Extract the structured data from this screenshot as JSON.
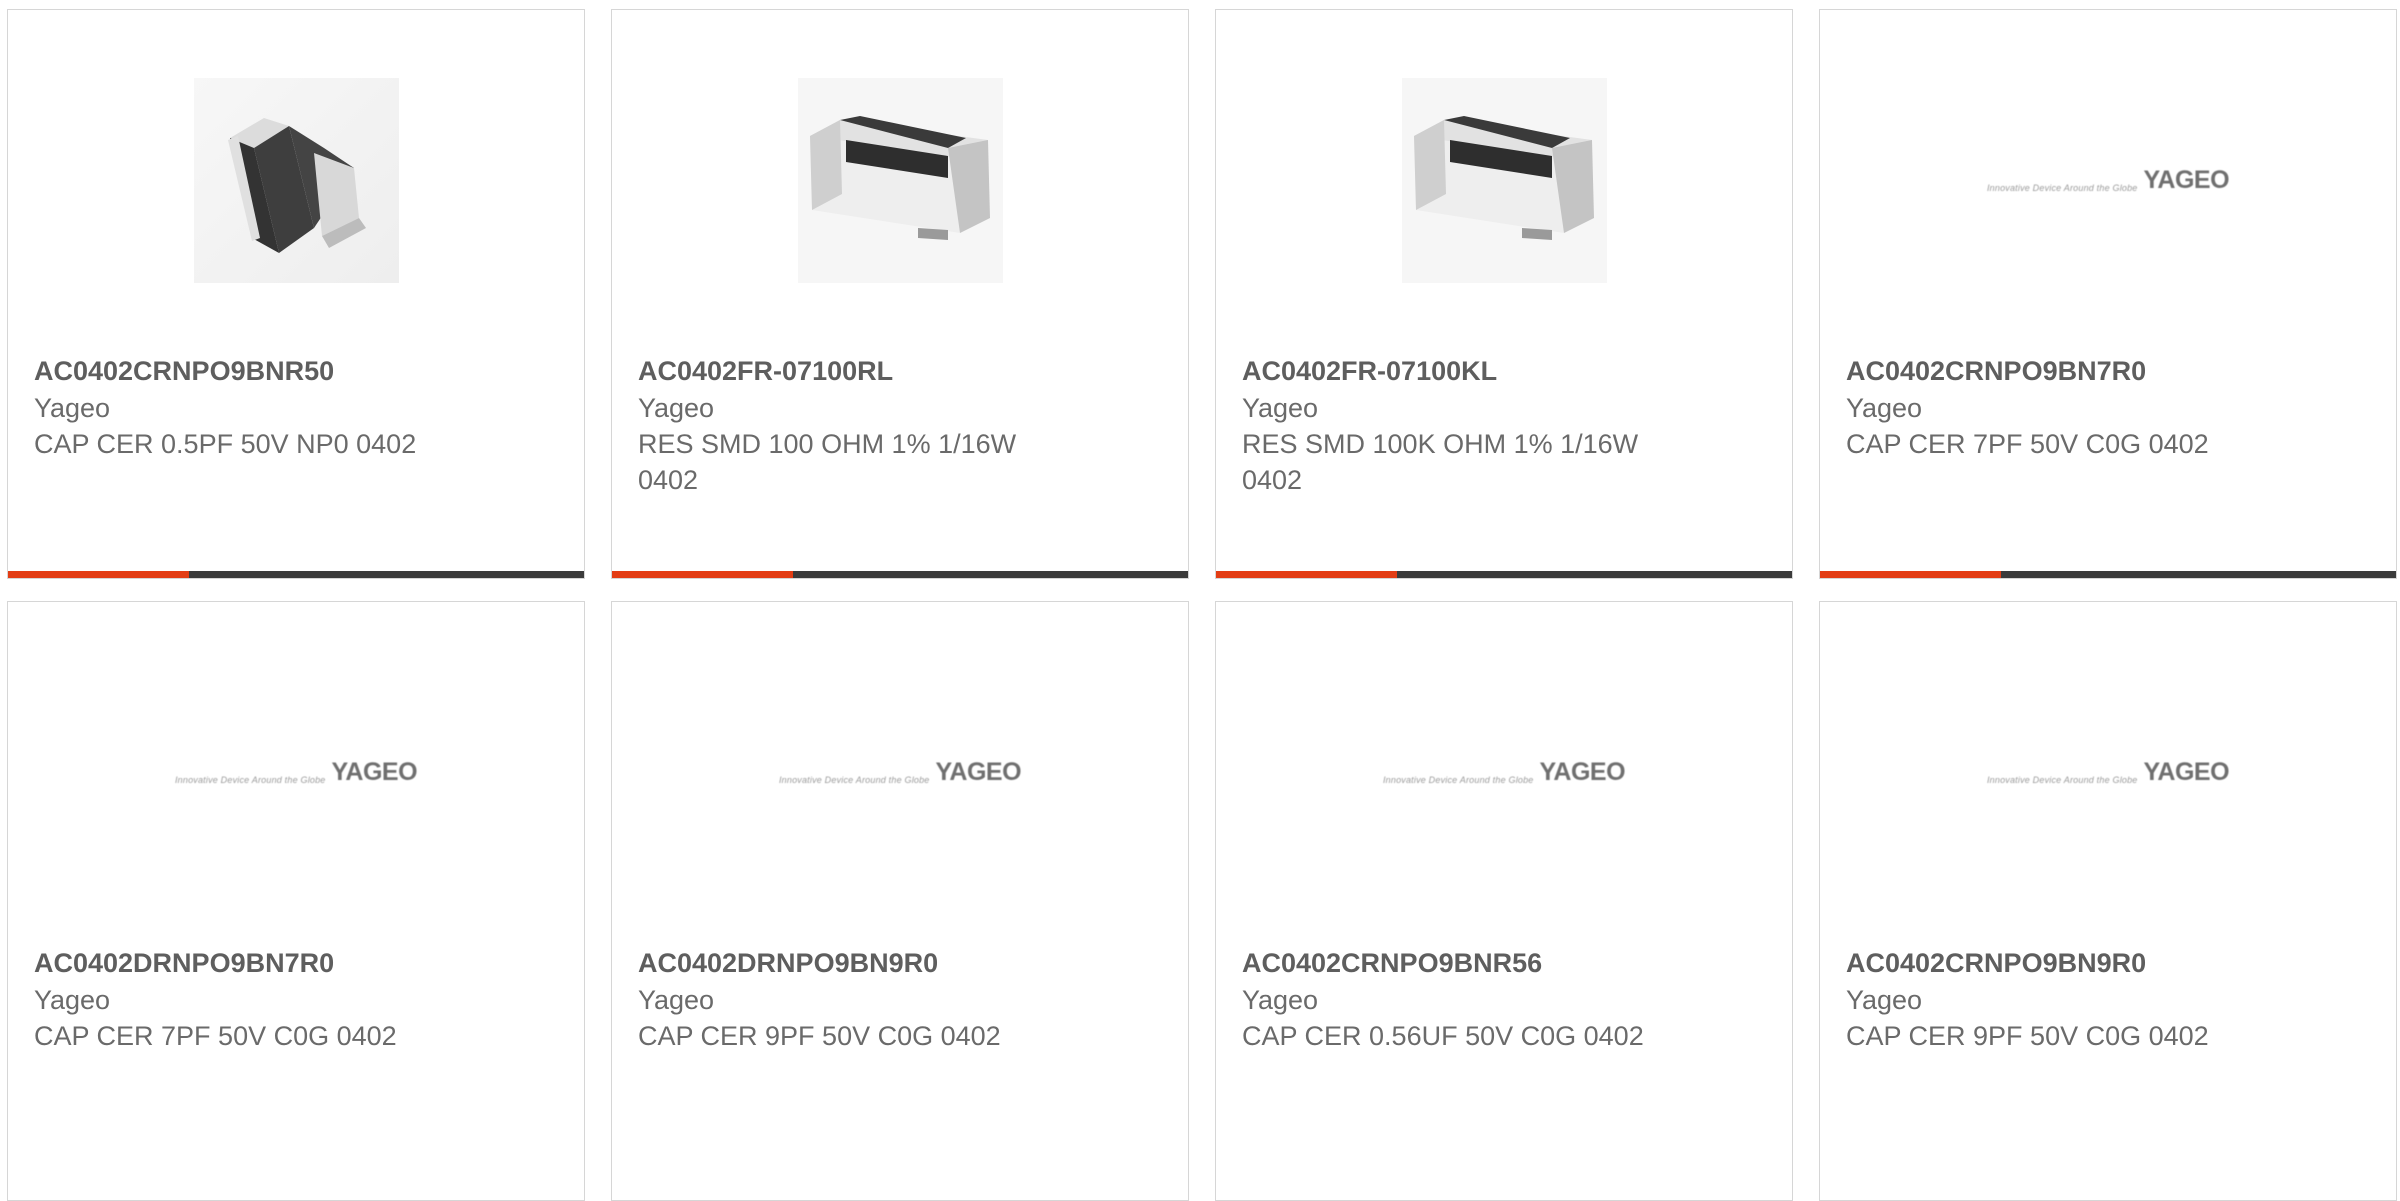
{
  "products": [
    {
      "part": "AC0402CRNPO9BNR50",
      "maker": "Yageo",
      "desc": "CAP CER 0.5PF 50V NP0 0402",
      "image": "capacitor-chip-icon"
    },
    {
      "part": "AC0402FR-07100RL",
      "maker": "Yageo",
      "desc": "RES SMD 100 OHM 1% 1/16W 0402",
      "image": "resistor-chip-icon"
    },
    {
      "part": "AC0402FR-07100KL",
      "maker": "Yageo",
      "desc": "RES SMD 100K OHM 1% 1/16W 0402",
      "image": "resistor-chip-icon"
    },
    {
      "part": "AC0402CRNPO9BN7R0",
      "maker": "Yageo",
      "desc": "CAP CER 7PF 50V C0G 0402",
      "image": "yageo-logo"
    },
    {
      "part": "AC0402DRNPO9BN7R0",
      "maker": "Yageo",
      "desc": "CAP CER 7PF 50V C0G 0402",
      "image": "yageo-logo"
    },
    {
      "part": "AC0402DRNPO9BN9R0",
      "maker": "Yageo",
      "desc": "CAP CER 9PF 50V C0G 0402",
      "image": "yageo-logo"
    },
    {
      "part": "AC0402CRNPO9BNR56",
      "maker": "Yageo",
      "desc": "CAP CER 0.56UF 50V C0G 0402",
      "image": "yageo-logo"
    },
    {
      "part": "AC0402CRNPO9BN9R0",
      "maker": "Yageo",
      "desc": "CAP CER 9PF 50V C0G 0402",
      "image": "yageo-logo"
    }
  ],
  "logo": {
    "tagline": "Innovative Device Around the Globe",
    "word": "YAGEO"
  },
  "colors": {
    "accent": "#e33d14",
    "bar": "#3b3b3b",
    "border": "#d6d6d6"
  }
}
